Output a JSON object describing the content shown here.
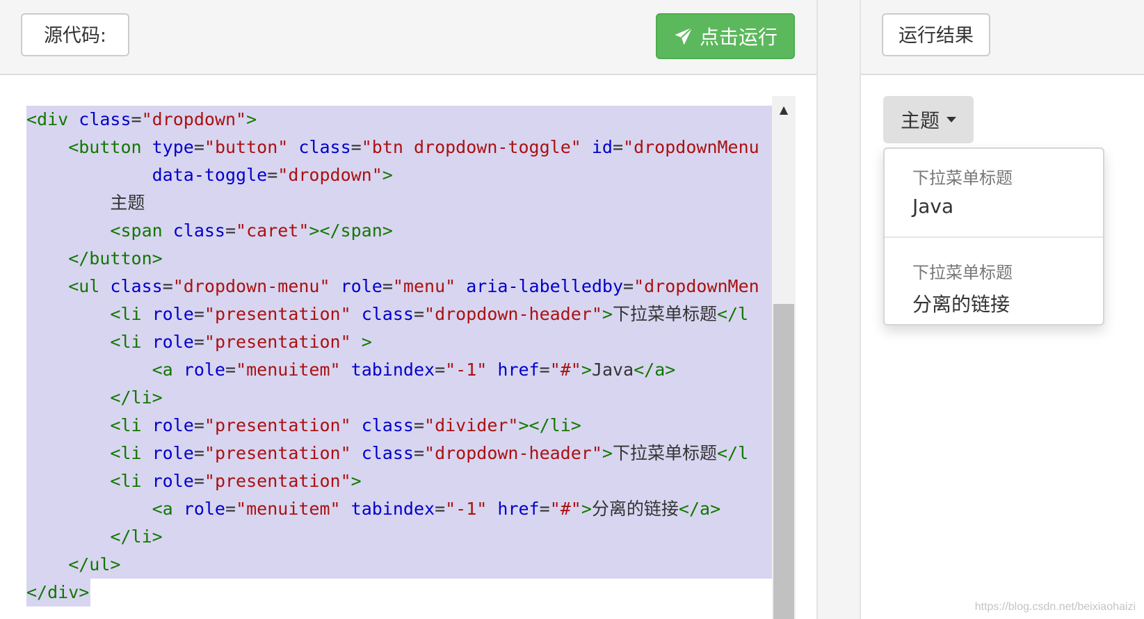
{
  "source_panel": {
    "label": "源代码:",
    "run_button_label": "点击运行"
  },
  "code_lines": [
    [
      {
        "t": "tag",
        "v": "<div "
      },
      {
        "t": "attr",
        "v": "class"
      },
      {
        "t": "txt",
        "v": "="
      },
      {
        "t": "str",
        "v": "\"dropdown\""
      },
      {
        "t": "tag",
        "v": ">"
      }
    ],
    [
      {
        "t": "tag",
        "v": "    <button "
      },
      {
        "t": "attr",
        "v": "type"
      },
      {
        "t": "txt",
        "v": "="
      },
      {
        "t": "str",
        "v": "\"button\""
      },
      {
        "t": "txt",
        "v": " "
      },
      {
        "t": "attr",
        "v": "class"
      },
      {
        "t": "txt",
        "v": "="
      },
      {
        "t": "str",
        "v": "\"btn dropdown-toggle\""
      },
      {
        "t": "txt",
        "v": " "
      },
      {
        "t": "attr",
        "v": "id"
      },
      {
        "t": "txt",
        "v": "="
      },
      {
        "t": "str",
        "v": "\"dropdownMenu"
      }
    ],
    [
      {
        "t": "txt",
        "v": "            "
      },
      {
        "t": "attr",
        "v": "data-toggle"
      },
      {
        "t": "txt",
        "v": "="
      },
      {
        "t": "str",
        "v": "\"dropdown\""
      },
      {
        "t": "tag",
        "v": ">"
      }
    ],
    [
      {
        "t": "txt",
        "v": "        主题"
      }
    ],
    [
      {
        "t": "tag",
        "v": "        <span "
      },
      {
        "t": "attr",
        "v": "class"
      },
      {
        "t": "txt",
        "v": "="
      },
      {
        "t": "str",
        "v": "\"caret\""
      },
      {
        "t": "tag",
        "v": "></span>"
      }
    ],
    [
      {
        "t": "tag",
        "v": "    </button>"
      }
    ],
    [
      {
        "t": "tag",
        "v": "    <ul "
      },
      {
        "t": "attr",
        "v": "class"
      },
      {
        "t": "txt",
        "v": "="
      },
      {
        "t": "str",
        "v": "\"dropdown-menu\""
      },
      {
        "t": "txt",
        "v": " "
      },
      {
        "t": "attr",
        "v": "role"
      },
      {
        "t": "txt",
        "v": "="
      },
      {
        "t": "str",
        "v": "\"menu\""
      },
      {
        "t": "txt",
        "v": " "
      },
      {
        "t": "attr",
        "v": "aria-labelledby"
      },
      {
        "t": "txt",
        "v": "="
      },
      {
        "t": "str",
        "v": "\"dropdownMen"
      }
    ],
    [
      {
        "t": "tag",
        "v": "        <li "
      },
      {
        "t": "attr",
        "v": "role"
      },
      {
        "t": "txt",
        "v": "="
      },
      {
        "t": "str",
        "v": "\"presentation\""
      },
      {
        "t": "txt",
        "v": " "
      },
      {
        "t": "attr",
        "v": "class"
      },
      {
        "t": "txt",
        "v": "="
      },
      {
        "t": "str",
        "v": "\"dropdown-header\""
      },
      {
        "t": "tag",
        "v": ">"
      },
      {
        "t": "txt",
        "v": "下拉菜单标题"
      },
      {
        "t": "tag",
        "v": "</l"
      }
    ],
    [
      {
        "t": "tag",
        "v": "        <li "
      },
      {
        "t": "attr",
        "v": "role"
      },
      {
        "t": "txt",
        "v": "="
      },
      {
        "t": "str",
        "v": "\"presentation\""
      },
      {
        "t": "txt",
        "v": " "
      },
      {
        "t": "tag",
        "v": ">"
      }
    ],
    [
      {
        "t": "tag",
        "v": "            <a "
      },
      {
        "t": "attr",
        "v": "role"
      },
      {
        "t": "txt",
        "v": "="
      },
      {
        "t": "str",
        "v": "\"menuitem\""
      },
      {
        "t": "txt",
        "v": " "
      },
      {
        "t": "attr",
        "v": "tabindex"
      },
      {
        "t": "txt",
        "v": "="
      },
      {
        "t": "str",
        "v": "\"-1\""
      },
      {
        "t": "txt",
        "v": " "
      },
      {
        "t": "attr",
        "v": "href"
      },
      {
        "t": "txt",
        "v": "="
      },
      {
        "t": "str",
        "v": "\"#\""
      },
      {
        "t": "tag",
        "v": ">"
      },
      {
        "t": "txt",
        "v": "Java"
      },
      {
        "t": "tag",
        "v": "</a>"
      }
    ],
    [
      {
        "t": "tag",
        "v": "        </li>"
      }
    ],
    [
      {
        "t": "tag",
        "v": "        <li "
      },
      {
        "t": "attr",
        "v": "role"
      },
      {
        "t": "txt",
        "v": "="
      },
      {
        "t": "str",
        "v": "\"presentation\""
      },
      {
        "t": "txt",
        "v": " "
      },
      {
        "t": "attr",
        "v": "class"
      },
      {
        "t": "txt",
        "v": "="
      },
      {
        "t": "str",
        "v": "\"divider\""
      },
      {
        "t": "tag",
        "v": "></li>"
      }
    ],
    [
      {
        "t": "tag",
        "v": "        <li "
      },
      {
        "t": "attr",
        "v": "role"
      },
      {
        "t": "txt",
        "v": "="
      },
      {
        "t": "str",
        "v": "\"presentation\""
      },
      {
        "t": "txt",
        "v": " "
      },
      {
        "t": "attr",
        "v": "class"
      },
      {
        "t": "txt",
        "v": "="
      },
      {
        "t": "str",
        "v": "\"dropdown-header\""
      },
      {
        "t": "tag",
        "v": ">"
      },
      {
        "t": "txt",
        "v": "下拉菜单标题"
      },
      {
        "t": "tag",
        "v": "</l"
      }
    ],
    [
      {
        "t": "tag",
        "v": "        <li "
      },
      {
        "t": "attr",
        "v": "role"
      },
      {
        "t": "txt",
        "v": "="
      },
      {
        "t": "str",
        "v": "\"presentation\""
      },
      {
        "t": "tag",
        "v": ">"
      }
    ],
    [
      {
        "t": "tag",
        "v": "            <a "
      },
      {
        "t": "attr",
        "v": "role"
      },
      {
        "t": "txt",
        "v": "="
      },
      {
        "t": "str",
        "v": "\"menuitem\""
      },
      {
        "t": "txt",
        "v": " "
      },
      {
        "t": "attr",
        "v": "tabindex"
      },
      {
        "t": "txt",
        "v": "="
      },
      {
        "t": "str",
        "v": "\"-1\""
      },
      {
        "t": "txt",
        "v": " "
      },
      {
        "t": "attr",
        "v": "href"
      },
      {
        "t": "txt",
        "v": "="
      },
      {
        "t": "str",
        "v": "\"#\""
      },
      {
        "t": "tag",
        "v": ">"
      },
      {
        "t": "txt",
        "v": "分离的链接"
      },
      {
        "t": "tag",
        "v": "</a>"
      }
    ],
    [
      {
        "t": "tag",
        "v": "        </li>"
      }
    ],
    [
      {
        "t": "tag",
        "v": "    </ul>"
      }
    ],
    [
      {
        "t": "tag",
        "v": "</div>"
      }
    ]
  ],
  "result_panel": {
    "label": "运行结果",
    "theme_button_label": "主题",
    "menu": {
      "header_1": "下拉菜单标题",
      "item_1": "Java",
      "header_2": "下拉菜单标题",
      "item_2": "分离的链接"
    }
  },
  "watermark": "https://blog.csdn.net/beixiaohaizi",
  "colors": {
    "run_button": "#5cb85c",
    "selection": "#d8d5f0",
    "tag": "#117700",
    "attr": "#0000cc",
    "string": "#aa1111"
  },
  "icons": {
    "run": "paper-plane-icon",
    "theme_caret": "caret-down-icon",
    "scroll_up": "arrow-up-icon"
  }
}
